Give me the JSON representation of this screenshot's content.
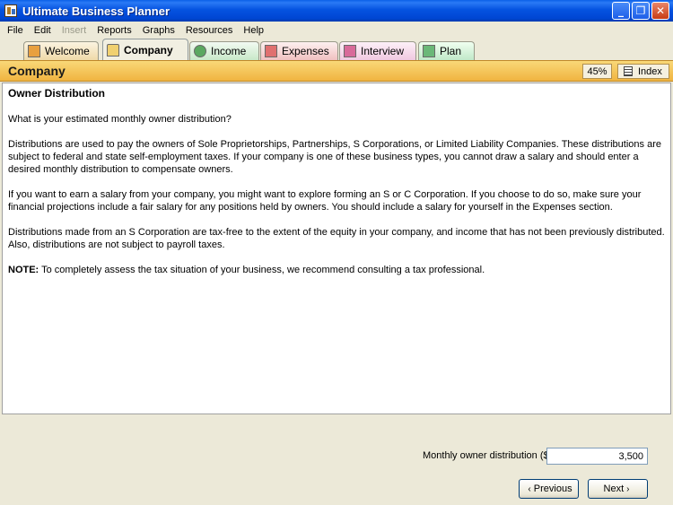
{
  "window": {
    "title": "Ultimate Business Planner",
    "minimize_glyph": "_",
    "maximize_glyph": "❐",
    "close_glyph": "✕"
  },
  "menu": [
    "File",
    "Edit",
    "Insert",
    "Reports",
    "Graphs",
    "Resources",
    "Help"
  ],
  "menu_disabled": [
    "Insert"
  ],
  "tabs": [
    {
      "label": "Welcome",
      "icon": "welcome-icon"
    },
    {
      "label": "Company",
      "icon": "company-icon",
      "active": true
    },
    {
      "label": "Income",
      "icon": "income-icon"
    },
    {
      "label": "Expenses",
      "icon": "expenses-icon"
    },
    {
      "label": "Interview",
      "icon": "interview-icon"
    },
    {
      "label": "Plan",
      "icon": "plan-icon"
    }
  ],
  "header": {
    "title": "Company",
    "progress": "45%",
    "index_label": "Index"
  },
  "content": {
    "heading": "Owner Distribution",
    "question": "What is your estimated monthly owner distribution?",
    "paragraph1": "Distributions are used to pay the owners of Sole Proprietorships, Partnerships, S Corporations, or Limited Liability Companies. These distributions are subject to federal and state self-employment taxes. If your company is one of these business types, you cannot draw a salary and should enter a desired monthly distribution to compensate owners.",
    "paragraph2": "If you want to earn a salary from your company, you might want to explore forming an S or C Corporation. If you choose to do so, make sure your financial projections include a fair salary for any positions held by owners. You should include a salary for yourself in the Expenses section.",
    "paragraph3": "Distributions made from an S Corporation are tax-free to the extent of the equity in your company, and income that has not been previously distributed. Also, distributions are not subject to payroll taxes.",
    "note_label": "NOTE:",
    "note_text": " To completely assess the tax situation of your business, we recommend consulting a tax professional."
  },
  "form": {
    "label": "Monthly owner distribution ($):",
    "value": "3,500"
  },
  "nav": {
    "previous": "Previous",
    "next": "Next",
    "prev_glyph": "‹",
    "next_glyph": "›"
  },
  "colors": {
    "title_bar": "#0553e0",
    "header_bar": "#f0b440"
  }
}
